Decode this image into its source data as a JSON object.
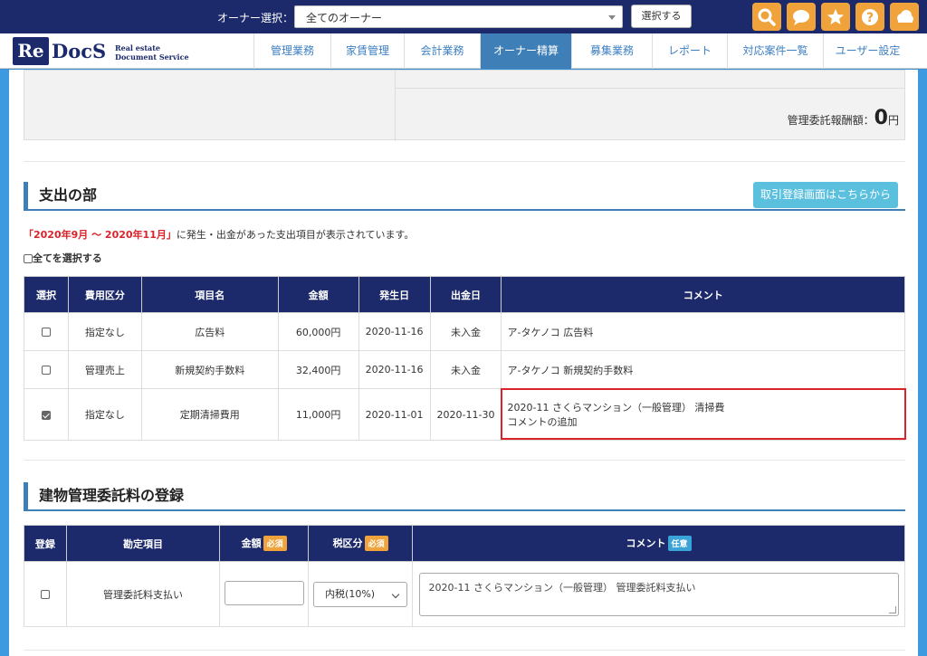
{
  "topbar": {
    "owner_label": "オーナー選択：",
    "owner_selected": "全てのオーナー",
    "select_button": "選択する",
    "icons": [
      "search-icon",
      "chat-icon",
      "star-icon",
      "help-icon",
      "cloud-icon"
    ],
    "accent_color": "#f0a33a",
    "bar_color": "#1c2a6b"
  },
  "logo": {
    "re": "Re",
    "docs": "DocS",
    "sub_line1": "Real estate",
    "sub_line2": "Document Service"
  },
  "nav": {
    "items": [
      "管理業務",
      "家賃管理",
      "会計業務",
      "オーナー精算",
      "募集業務",
      "レポート",
      "対応案件一覧",
      "ユーザー設定"
    ],
    "active": "オーナー精算"
  },
  "summary": {
    "fee_label": "管理委託報酬額：",
    "fee_value": "0",
    "fee_unit": "円"
  },
  "expense": {
    "title": "支出の部",
    "link_button": "取引登録画面はこちらから",
    "period": "「2020年9月 ～ 2020年11月」",
    "period_suffix": "に発生・出金があった支出項目が表示されています。",
    "select_all": "全てを選択する",
    "headers": [
      "選択",
      "費用区分",
      "項目名",
      "金額",
      "発生日",
      "出金日",
      "コメント"
    ],
    "rows": [
      {
        "checked": false,
        "category": "指定なし",
        "item": "広告料",
        "amount": "60,000円",
        "occurred": "2020-11-16",
        "paid": "未入金",
        "comment1": "ア-タケノコ 広告料",
        "comment2": ""
      },
      {
        "checked": false,
        "category": "管理売上",
        "item": "新規契約手数料",
        "amount": "32,400円",
        "occurred": "2020-11-16",
        "paid": "未入金",
        "comment1": "ア-タケノコ 新規契約手数料",
        "comment2": ""
      },
      {
        "checked": true,
        "category": "指定なし",
        "item": "定期清掃費用",
        "amount": "11,000円",
        "occurred": "2020-11-01",
        "paid": "2020-11-30",
        "comment1": "2020-11 さくらマンション（一般管理） 清掃費",
        "comment2": "コメントの追加"
      }
    ]
  },
  "commission": {
    "title": "建物管理委託料の登録",
    "headers": {
      "register": "登録",
      "account": "勘定項目",
      "amount": "金額",
      "tax": "税区分",
      "comment": "コメント"
    },
    "required_badge": "必須",
    "optional_badge": "任意",
    "row": {
      "checked": false,
      "account": "管理委託料支払い",
      "amount_value": "",
      "tax_selected": "内税(10%)",
      "comment_value": "2020-11 さくらマンション（一般管理） 管理委託料支払い"
    }
  }
}
